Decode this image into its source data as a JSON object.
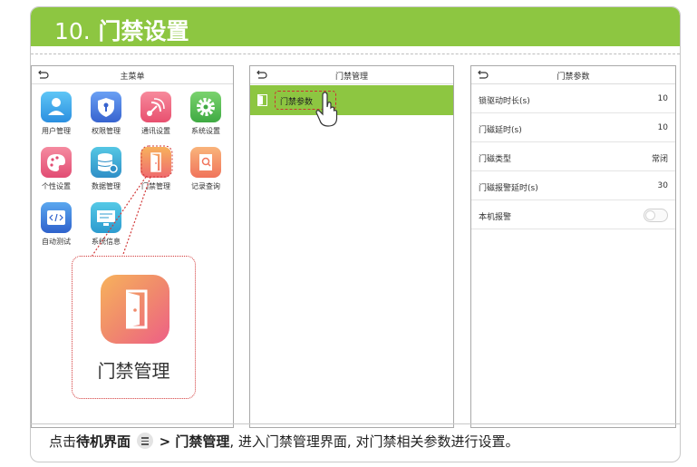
{
  "header": {
    "number": "10.",
    "title": "门禁设置"
  },
  "panel1": {
    "title": "主菜单",
    "apps": [
      {
        "label": "用户管理",
        "icon": "user-icon"
      },
      {
        "label": "权限管理",
        "icon": "shield-icon"
      },
      {
        "label": "通讯设置",
        "icon": "satellite-icon"
      },
      {
        "label": "系统设置",
        "icon": "gear-icon"
      },
      {
        "label": "个性设置",
        "icon": "palette-icon"
      },
      {
        "label": "数据管理",
        "icon": "database-icon"
      },
      {
        "label": "门禁管理",
        "icon": "door-icon"
      },
      {
        "label": "记录查询",
        "icon": "document-search-icon"
      },
      {
        "label": "自动测试",
        "icon": "code-icon"
      },
      {
        "label": "系统信息",
        "icon": "monitor-icon"
      }
    ],
    "callout_label": "门禁管理"
  },
  "panel2": {
    "title": "门禁管理",
    "item": "门禁参数"
  },
  "panel3": {
    "title": "门禁参数",
    "rows": [
      {
        "label": "锁驱动时长(s)",
        "value": "10"
      },
      {
        "label": "门磁延时(s)",
        "value": "10"
      },
      {
        "label": "门磁类型",
        "value": "常闭"
      },
      {
        "label": "门磁报警延时(s)",
        "value": "30"
      },
      {
        "label": "本机报警",
        "value": ""
      }
    ],
    "alarm_toggle_on": false
  },
  "footer": {
    "prefix": "点击",
    "standby": "待机界面",
    "arrow_target": "> 门禁管理",
    "suffix": ", 进入门禁管理界面, 对门禁相关参数进行设置。"
  },
  "colors": {
    "accent": "#8dc641",
    "highlight": "#d23a3a"
  }
}
